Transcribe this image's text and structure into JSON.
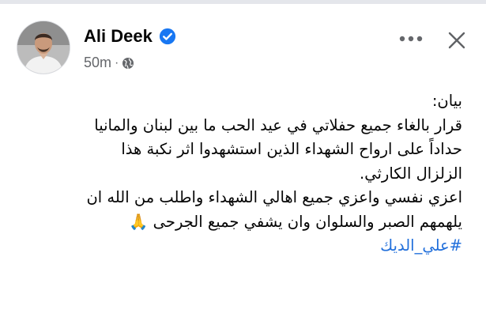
{
  "post": {
    "author": "Ali Deek",
    "time": "50m",
    "separator": "·",
    "lines": [
      "بيان:",
      "قرار بالغاء جميع حفلاتي في عيد الحب ما بين لبنان والمانيا",
      "حداداً على ارواح الشهداء الذين استشهدوا اثر نكبة هذا",
      "الزلزال الكارثي.",
      "اعزي نفسي واعزي جميع اهالي الشهداء واطلب من الله ان",
      "يلهمهم الصبر والسلوان وان يشفي جميع الجرحى 🙏"
    ],
    "hashtag": "#علي_الديك"
  },
  "icons": {
    "verified": "verified-badge-icon",
    "audience": "globe-icon",
    "more": "more-options-icon",
    "close": "close-icon"
  },
  "colors": {
    "verified": "#1877f2",
    "hashtag": "#216fdb",
    "meta": "#65676b"
  }
}
